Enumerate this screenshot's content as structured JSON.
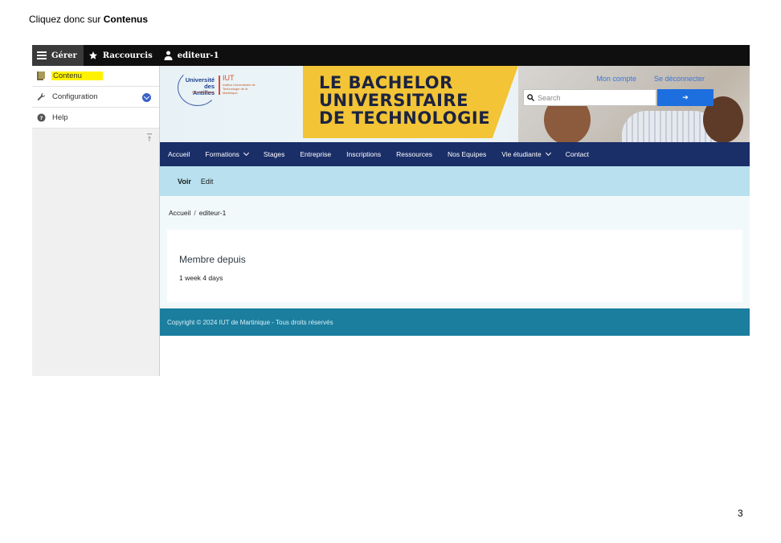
{
  "instruction": {
    "prefix": "Cliquez donc sur ",
    "target": "Contenus"
  },
  "toolbar": {
    "manage_label": "Gérer",
    "shortcuts_label": "Raccourcis",
    "user_label": "editeur-1"
  },
  "sidebar": {
    "items": [
      {
        "label": "Contenu",
        "icon": "content-icon",
        "highlight": "#fff200"
      },
      {
        "label": "Configuration",
        "icon": "wrench-icon"
      },
      {
        "label": "Help",
        "icon": "help-icon"
      }
    ]
  },
  "site": {
    "logo": {
      "university_line1": "Université",
      "university_line2": "des Antilles",
      "university_sub": "Pôle Martinique",
      "iut": "IUT",
      "iut_sub": "Institut Universitaire de Technologie de la Martinique"
    },
    "headline": [
      "LE BACHELOR",
      "UNIVERSITAIRE",
      "DE TECHNOLOGIE"
    ],
    "links": {
      "account": "Mon compte",
      "logout": "Se déconnecter"
    },
    "search": {
      "placeholder": "Search",
      "button": "➔"
    },
    "nav": [
      {
        "label": "Accueil",
        "dropdown": false
      },
      {
        "label": "Formations",
        "dropdown": true
      },
      {
        "label": "Stages",
        "dropdown": false
      },
      {
        "label": "Entreprise",
        "dropdown": false
      },
      {
        "label": "Inscriptions",
        "dropdown": false
      },
      {
        "label": "Ressources",
        "dropdown": false
      },
      {
        "label": "Nos Equipes",
        "dropdown": false
      },
      {
        "label": "Vie étudiante",
        "dropdown": true
      },
      {
        "label": "Contact",
        "dropdown": false
      }
    ],
    "tabs": {
      "view": "Voir",
      "edit": "Edit"
    },
    "breadcrumb": {
      "home": "Accueil",
      "separator": "/",
      "current": "editeur-1"
    },
    "member": {
      "label": "Membre depuis",
      "value": "1 week 4 days"
    },
    "footer": "Copyright © 2024 IUT de Martinique - Tous droits réservés"
  },
  "page_number": "3",
  "colors": {
    "nav": "#1a2e68",
    "tabs": "#b8e0ef",
    "footer": "#1b7e9e",
    "highlight": "#fff200",
    "accent": "#1d6fe0"
  }
}
